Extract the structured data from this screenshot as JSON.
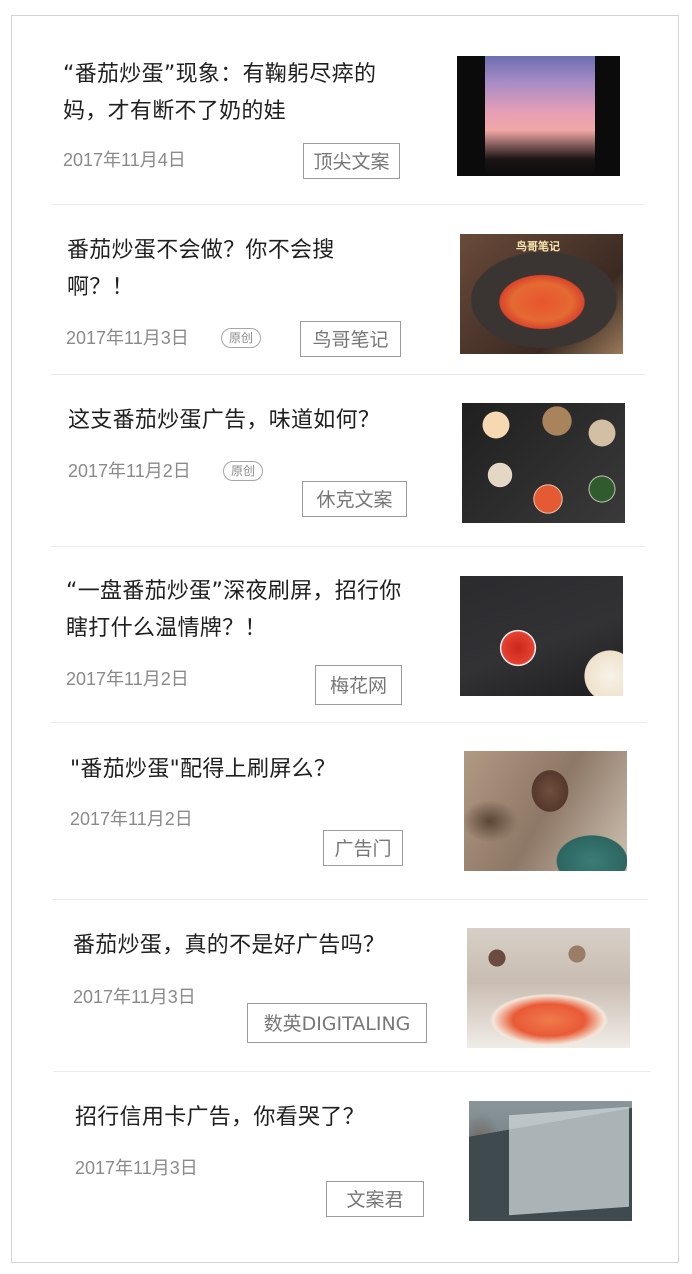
{
  "articles": [
    {
      "title_line1": "“番茄炒蛋”现象：有鞠躬尽瘁的",
      "title_line2": "妈，才有断不了奶的娃",
      "date": "2017年11月4日",
      "badge": "",
      "source": "顶尖文案",
      "thumbnail": "sunset-window-photo"
    },
    {
      "title_line1": "番茄炒蛋不会做？你不会搜",
      "title_line2": "啊？！",
      "date": "2017年11月3日",
      "badge": "原创",
      "source": "鸟哥笔记",
      "thumbnail": "tomato-egg-dish-photo",
      "thumb_caption": "鸟哥笔记"
    },
    {
      "title_line1": "这支番茄炒蛋广告，味道如何？",
      "title_line2": "",
      "date": "2017年11月2日",
      "badge": "原创",
      "source": "休克文案",
      "thumbnail": "dinner-table-photo"
    },
    {
      "title_line1": "“一盘番茄炒蛋”深夜刷屏，招行你",
      "title_line2": "瞎打什么温情牌？！",
      "date": "2017年11月2日",
      "badge": "",
      "source": "梅花网",
      "thumbnail": "tomato-slice-photo"
    },
    {
      "title_line1": "\"番茄炒蛋\"配得上刷屏么？",
      "title_line2": "",
      "date": "2017年11月2日",
      "badge": "",
      "source": "广告门",
      "thumbnail": "young-man-photo"
    },
    {
      "title_line1": "番茄炒蛋，真的不是好广告吗？",
      "title_line2": "",
      "date": "2017年11月3日",
      "badge": "",
      "source": "数英DIGITALING",
      "thumbnail": "tomato-dish-closeup-photo"
    },
    {
      "title_line1": "招行信用卡广告，你看哭了？",
      "title_line2": "",
      "date": "2017年11月3日",
      "badge": "",
      "source": "文案君",
      "thumbnail": "phone-screen-photo"
    }
  ]
}
